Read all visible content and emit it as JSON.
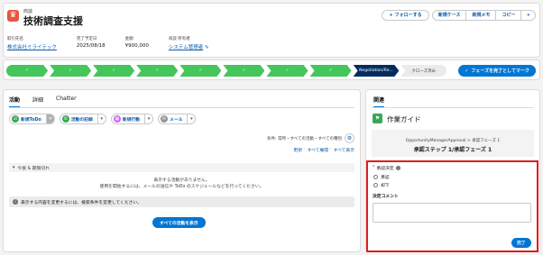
{
  "header": {
    "object_type": "商談",
    "title": "技術調査支援",
    "actions": {
      "follow": "フォローする",
      "new_case": "新規ケース",
      "new_memo": "新規メモ",
      "copy": "コピー"
    },
    "fields": [
      {
        "label": "取引先名",
        "value": "株式会社ミライテック",
        "link": true
      },
      {
        "label": "完了予定日",
        "value": "2025/08/18",
        "link": false
      },
      {
        "label": "金額",
        "value": "¥900,000",
        "link": false
      },
      {
        "label": "商談 所有者",
        "value": "システム管理者",
        "link": true
      }
    ]
  },
  "path": {
    "current_stage": "Negotiation/Re...",
    "next_stage": "クローズ済み",
    "completed_count": 8,
    "mark_button": "フェーズを完了としてマーク"
  },
  "left_panel": {
    "tabs": [
      "活動",
      "詳細",
      "Chatter"
    ],
    "active_tab": 0,
    "action_buttons": [
      "新規ToDo",
      "活動の記録",
      "新規行動",
      "メール"
    ],
    "filter_text": "条件: 常時・すべての活動・すべての種別",
    "links": {
      "refresh": "更新",
      "expand_all": "すべて展開",
      "show_all": "すべて表示"
    },
    "section_title": "今後 & 期限切れ",
    "empty_line1": "表示する活動がありません。",
    "empty_line2": "使用を開始するには、メールの送信や ToDo のスケジュールなどを行ってください。",
    "info_text": "表示する内容を変更するには、検索条件を変更してください。",
    "show_all_button": "すべての活動を表示"
  },
  "right_panel": {
    "tab": "関連",
    "guide_title": "作業ガイド",
    "guide_path": "OpportunityManagerApproval > 承認フェーズ 1",
    "guide_step": "承認ステップ 1/承認フェーズ 1",
    "question_label": "承認決定",
    "options": [
      "承認",
      "却下"
    ],
    "comment_label": "決定コメント",
    "done_button": "完了"
  },
  "colors": {
    "accent": "#0176d3",
    "path_done": "#45c65a",
    "path_current": "#032d60",
    "highlight": "#e11d1d"
  }
}
